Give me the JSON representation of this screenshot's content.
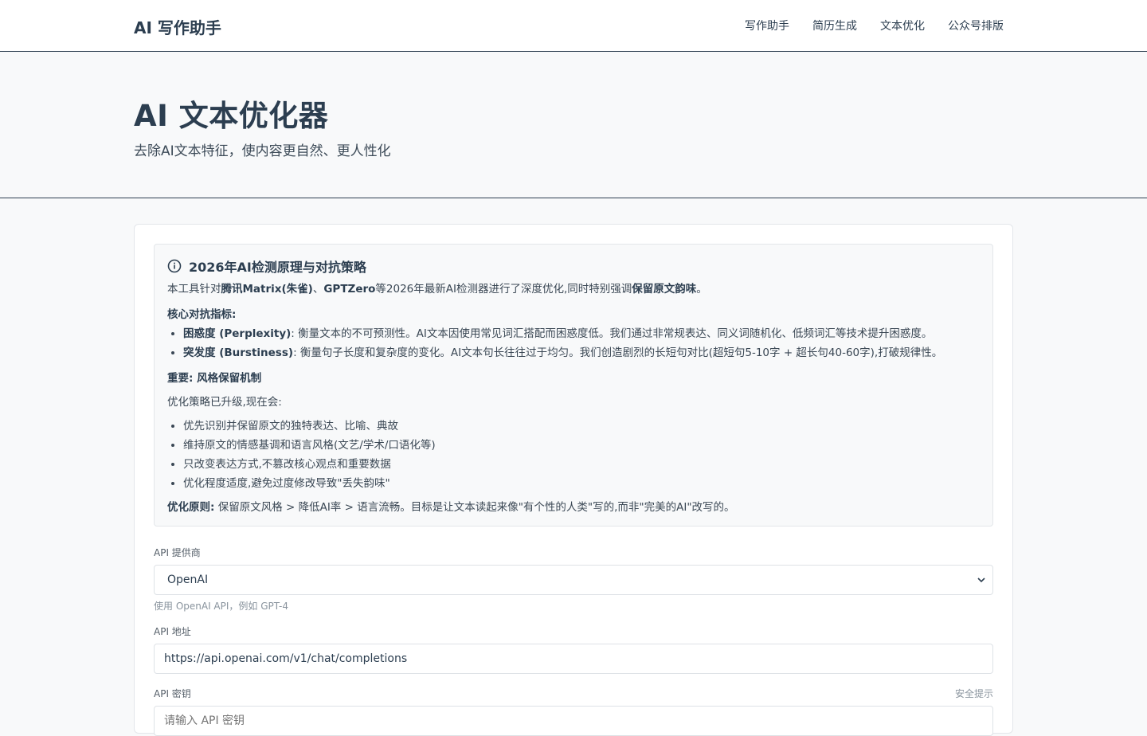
{
  "header": {
    "brand": "AI 写作助手",
    "nav": [
      "写作助手",
      "简历生成",
      "文本优化",
      "公众号排版"
    ]
  },
  "hero": {
    "title": "AI 文本优化器",
    "subtitle": "去除AI文本特征，使内容更自然、更人性化"
  },
  "info": {
    "title": "2026年AI检测原理与对抗策略",
    "intro": {
      "p1": "本工具针对",
      "b1": "腾讯Matrix(朱雀)",
      "p2": "、",
      "b2": "GPTZero",
      "p3": "等2026年最新AI检测器进行了深度优化,同时特别强调",
      "b3": "保留原文韵味",
      "p4": "。"
    },
    "core_heading": "核心对抗指标:",
    "metrics": [
      {
        "name": "困惑度 (Perplexity)",
        "text": ": 衡量文本的不可预测性。AI文本因使用常见词汇搭配而困惑度低。我们通过非常规表达、同义词随机化、低频词汇等技术提升困惑度。"
      },
      {
        "name": "突发度 (Burstiness)",
        "text": ": 衡量句子长度和复杂度的变化。AI文本句长往往过于均匀。我们创造剧烈的长短句对比(超短句5-10字 + 超长句40-60字),打破规律性。"
      }
    ],
    "important_heading": "重要: 风格保留机制",
    "upgrade_line": "优化策略已升级,现在会:",
    "strategies": [
      "优先识别并保留原文的独特表达、比喻、典故",
      "维持原文的情感基调和语言风格(文艺/学术/口语化等)",
      "只改变表达方式,不篡改核心观点和重要数据",
      "优化程度适度,避免过度修改导致\"丢失韵味\""
    ],
    "principle_label": "优化原则:",
    "principle_text": " 保留原文风格 > 降低AI率 > 语言流畅。目标是让文本读起来像\"有个性的人类\"写的,而非\"完美的AI\"改写的。"
  },
  "form": {
    "provider_label": "API 提供商",
    "provider_selected": "OpenAI",
    "provider_help": "使用 OpenAI API，例如 GPT-4",
    "url_label": "API 地址",
    "url_value": "https://api.openai.com/v1/chat/completions",
    "key_label": "API 密钥",
    "key_hint": "安全提示",
    "key_placeholder": "请输入 API 密钥"
  },
  "icons": {
    "info": "info-circle-icon",
    "select": "chevron-down-icon"
  }
}
